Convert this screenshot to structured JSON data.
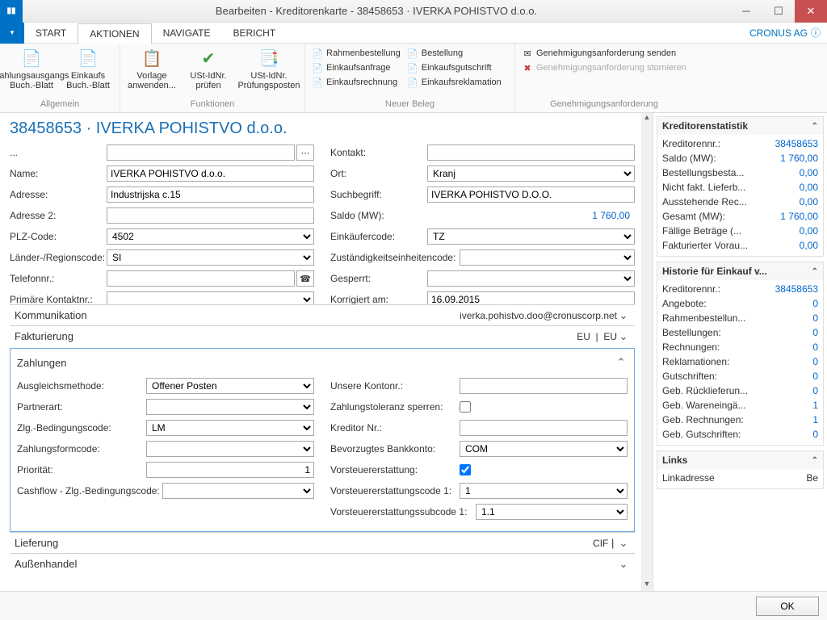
{
  "window": {
    "title": "Bearbeiten - Kreditorenkarte - 38458653 · IVERKA POHISTVO d.o.o.",
    "company": "CRONUS AG"
  },
  "tabs": {
    "start": "START",
    "aktionen": "AKTIONEN",
    "navigate": "NAVIGATE",
    "bericht": "BERICHT"
  },
  "ribbon": {
    "allgemein": {
      "label": "Allgemein",
      "zahlungsausgangs": "Zahlungsausgangs\nBuch.-Blatt",
      "einkaufs": "Einkaufs\nBuch.-Blatt"
    },
    "funktionen": {
      "label": "Funktionen",
      "vorlage": "Vorlage\nanwenden...",
      "ustprufen": "USt-IdNr.\nprüfen",
      "ustposten": "USt-IdNr.\nPrüfungsposten"
    },
    "neuerbeleg": {
      "label": "Neuer Beleg",
      "rahmen": "Rahmenbestellung",
      "anfrage": "Einkaufsanfrage",
      "rechnung": "Einkaufsrechnung",
      "bestellung": "Bestellung",
      "gutschrift": "Einkaufsgutschrift",
      "reklamation": "Einkaufsreklamation"
    },
    "genehmigung": {
      "label": "Genehmigungsanforderung",
      "senden": "Genehmigungsanforderung senden",
      "storn": "Genehmigungsanforderung stornieren"
    }
  },
  "page": {
    "title": "38458653 · IVERKA POHISTVO d.o.o."
  },
  "general": {
    "name_lbl": "Name:",
    "name": "IVERKA POHISTVO d.o.o.",
    "addr_lbl": "Adresse:",
    "addr": "Industrijska c.15",
    "addr2_lbl": "Adresse 2:",
    "addr2": "",
    "plz_lbl": "PLZ-Code:",
    "plz": "4502",
    "region_lbl": "Länder-/Regionscode:",
    "region": "SI",
    "tel_lbl": "Telefonnr.:",
    "tel": "",
    "primkontakt_lbl": "Primäre Kontaktnr.:",
    "primkontakt": "",
    "kontakt_lbl": "Kontakt:",
    "kontakt": "",
    "ort_lbl": "Ort:",
    "ort": "Kranj",
    "such_lbl": "Suchbegriff:",
    "such": "IVERKA POHISTVO D.O.O.",
    "saldo_lbl": "Saldo (MW):",
    "saldo": "1 760,00",
    "einkaufer_lbl": "Einkäufercode:",
    "einkaufer": "TZ",
    "zust_lbl": "Zuständigkeitseinheitencode:",
    "zust": "",
    "gesperrt_lbl": "Gesperrt:",
    "gesperrt": "",
    "korrig_lbl": "Korrigiert am:",
    "korrig": "16.09.2015"
  },
  "sections": {
    "kommunikation": {
      "label": "Kommunikation",
      "value": "iverka.pohistvo.doo@cronuscorp.net"
    },
    "fakturierung": {
      "label": "Fakturierung",
      "v1": "EU",
      "v2": "EU"
    },
    "zahlungen": {
      "label": "Zahlungen"
    },
    "lieferung": {
      "label": "Lieferung",
      "value": "CIF"
    },
    "aussen": {
      "label": "Außenhandel"
    }
  },
  "zahlungen": {
    "ausgleich_lbl": "Ausgleichsmethode:",
    "ausgleich": "Offener Posten",
    "partner_lbl": "Partnerart:",
    "partner": "",
    "zlgbed_lbl": "Zlg.-Bedingungscode:",
    "zlgbed": "LM",
    "zform_lbl": "Zahlungsformcode:",
    "zform": "",
    "prio_lbl": "Priorität:",
    "prio": "1",
    "cashflow_lbl": "Cashflow - Zlg.-Bedingungscode:",
    "cashflow": "",
    "konto_lbl": "Unsere Kontonr.:",
    "konto": "",
    "tol_lbl": "Zahlungstoleranz sperren:",
    "krednr_lbl": "Kreditor Nr.:",
    "krednr": "",
    "bank_lbl": "Bevorzugtes Bankkonto:",
    "bank": "COM",
    "vst_lbl": "Vorsteuererstattung:",
    "vstcode_lbl": "Vorsteuererstattungscode 1:",
    "vstcode": "1",
    "vstsub_lbl": "Vorsteuererstattungssubcode 1:",
    "vstsub": "1.1"
  },
  "stats": {
    "title": "Kreditorenstatistik",
    "rows": [
      {
        "label": "Kreditorennr.:",
        "value": "38458653"
      },
      {
        "label": "Saldo (MW):",
        "value": "1 760,00"
      },
      {
        "label": "Bestellungsbesta...",
        "value": "0,00"
      },
      {
        "label": "Nicht fakt. Lieferb...",
        "value": "0,00"
      },
      {
        "label": "Ausstehende Rec...",
        "value": "0,00"
      },
      {
        "label": "Gesamt (MW):",
        "value": "1 760,00"
      },
      {
        "label": "Fällige Beträge (...",
        "value": "0,00"
      },
      {
        "label": "Fakturierter Vorau...",
        "value": "0,00"
      }
    ]
  },
  "historie": {
    "title": "Historie für Einkauf v...",
    "rows": [
      {
        "label": "Kreditorennr.:",
        "value": "38458653"
      },
      {
        "label": "Angebote:",
        "value": "0"
      },
      {
        "label": "Rahmenbestellun...",
        "value": "0"
      },
      {
        "label": "Bestellungen:",
        "value": "0"
      },
      {
        "label": "Rechnungen:",
        "value": "0"
      },
      {
        "label": "Reklamationen:",
        "value": "0"
      },
      {
        "label": "Gutschriften:",
        "value": "0"
      },
      {
        "label": "Geb. Rücklieferun...",
        "value": "0"
      },
      {
        "label": "Geb. Wareneingä...",
        "value": "1"
      },
      {
        "label": "Geb. Rechnungen:",
        "value": "1"
      },
      {
        "label": "Geb. Gutschriften:",
        "value": "0"
      }
    ]
  },
  "links": {
    "title": "Links",
    "column": "Linkadresse",
    "col2": "Be"
  },
  "buttons": {
    "ok": "OK"
  }
}
